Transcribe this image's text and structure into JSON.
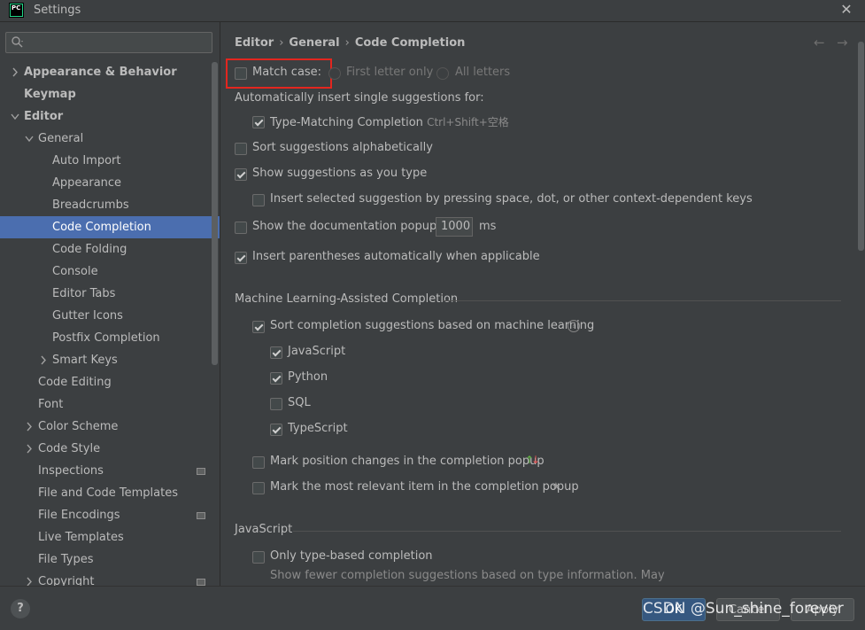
{
  "window": {
    "title": "Settings",
    "app_icon_text": "PC"
  },
  "search": {
    "placeholder": ""
  },
  "breadcrumb": [
    "Editor",
    "General",
    "Code Completion"
  ],
  "tree": [
    {
      "label": "Appearance & Behavior",
      "level": 0,
      "arrow": "right",
      "bold": true
    },
    {
      "label": "Keymap",
      "level": 0,
      "arrow": "none",
      "bold": true
    },
    {
      "label": "Editor",
      "level": 0,
      "arrow": "down",
      "bold": true
    },
    {
      "label": "General",
      "level": 1,
      "arrow": "down"
    },
    {
      "label": "Auto Import",
      "level": 2,
      "arrow": "none"
    },
    {
      "label": "Appearance",
      "level": 2,
      "arrow": "none"
    },
    {
      "label": "Breadcrumbs",
      "level": 2,
      "arrow": "none"
    },
    {
      "label": "Code Completion",
      "level": 2,
      "arrow": "none",
      "selected": true
    },
    {
      "label": "Code Folding",
      "level": 2,
      "arrow": "none"
    },
    {
      "label": "Console",
      "level": 2,
      "arrow": "none"
    },
    {
      "label": "Editor Tabs",
      "level": 2,
      "arrow": "none"
    },
    {
      "label": "Gutter Icons",
      "level": 2,
      "arrow": "none"
    },
    {
      "label": "Postfix Completion",
      "level": 2,
      "arrow": "none"
    },
    {
      "label": "Smart Keys",
      "level": 2,
      "arrow": "right"
    },
    {
      "label": "Code Editing",
      "level": 1,
      "arrow": "none"
    },
    {
      "label": "Font",
      "level": 1,
      "arrow": "none"
    },
    {
      "label": "Color Scheme",
      "level": 1,
      "arrow": "right"
    },
    {
      "label": "Code Style",
      "level": 1,
      "arrow": "right"
    },
    {
      "label": "Inspections",
      "level": 1,
      "arrow": "none",
      "project_icon": true
    },
    {
      "label": "File and Code Templates",
      "level": 1,
      "arrow": "none"
    },
    {
      "label": "File Encodings",
      "level": 1,
      "arrow": "none",
      "project_icon": true
    },
    {
      "label": "Live Templates",
      "level": 1,
      "arrow": "none"
    },
    {
      "label": "File Types",
      "level": 1,
      "arrow": "none"
    },
    {
      "label": "Copyright",
      "level": 1,
      "arrow": "right",
      "project_icon": true
    }
  ],
  "settings": {
    "match_case": {
      "label": "Match case:",
      "checked": false
    },
    "first_letter_only": {
      "label": "First letter only"
    },
    "all_letters": {
      "label": "All letters"
    },
    "auto_insert_heading": "Automatically insert single suggestions for:",
    "type_matching": {
      "label": "Type-Matching Completion",
      "shortcut": "Ctrl+Shift+空格",
      "checked": true
    },
    "sort_alpha": {
      "label": "Sort suggestions alphabetically",
      "checked": false
    },
    "show_as_type": {
      "label": "Show suggestions as you type",
      "checked": true
    },
    "insert_selected": {
      "label": "Insert selected suggestion by pressing space, dot, or other context-dependent keys",
      "checked": false
    },
    "doc_popup": {
      "label": "Show the documentation popup in",
      "value": "1000",
      "unit": "ms",
      "checked": false
    },
    "insert_parens": {
      "label": "Insert parentheses automatically when applicable",
      "checked": true
    },
    "ml_section": "Machine Learning-Assisted Completion",
    "ml_sort": {
      "label": "Sort completion suggestions based on machine learning",
      "checked": true
    },
    "ml_langs": [
      {
        "label": "JavaScript",
        "checked": true
      },
      {
        "label": "Python",
        "checked": true
      },
      {
        "label": "SQL",
        "checked": false
      },
      {
        "label": "TypeScript",
        "checked": true
      }
    ],
    "mark_position": {
      "label": "Mark position changes in the completion popup",
      "checked": false
    },
    "mark_relevant": {
      "label": "Mark the most relevant item in the completion popup",
      "checked": false
    },
    "js_section": "JavaScript",
    "type_based": {
      "label": "Only type-based completion",
      "checked": false
    },
    "type_based_hint": "Show fewer completion suggestions based on type information. May"
  },
  "footer": {
    "help_label": "?",
    "ok_label": "OK",
    "cancel_label": "Cancel",
    "apply_label": "Apply",
    "watermark": "CSDN @Sun_shine_forever"
  },
  "colors": {
    "selection": "#4b6eaf",
    "highlight_box": "#e3261f",
    "ok_button": "#365880"
  }
}
